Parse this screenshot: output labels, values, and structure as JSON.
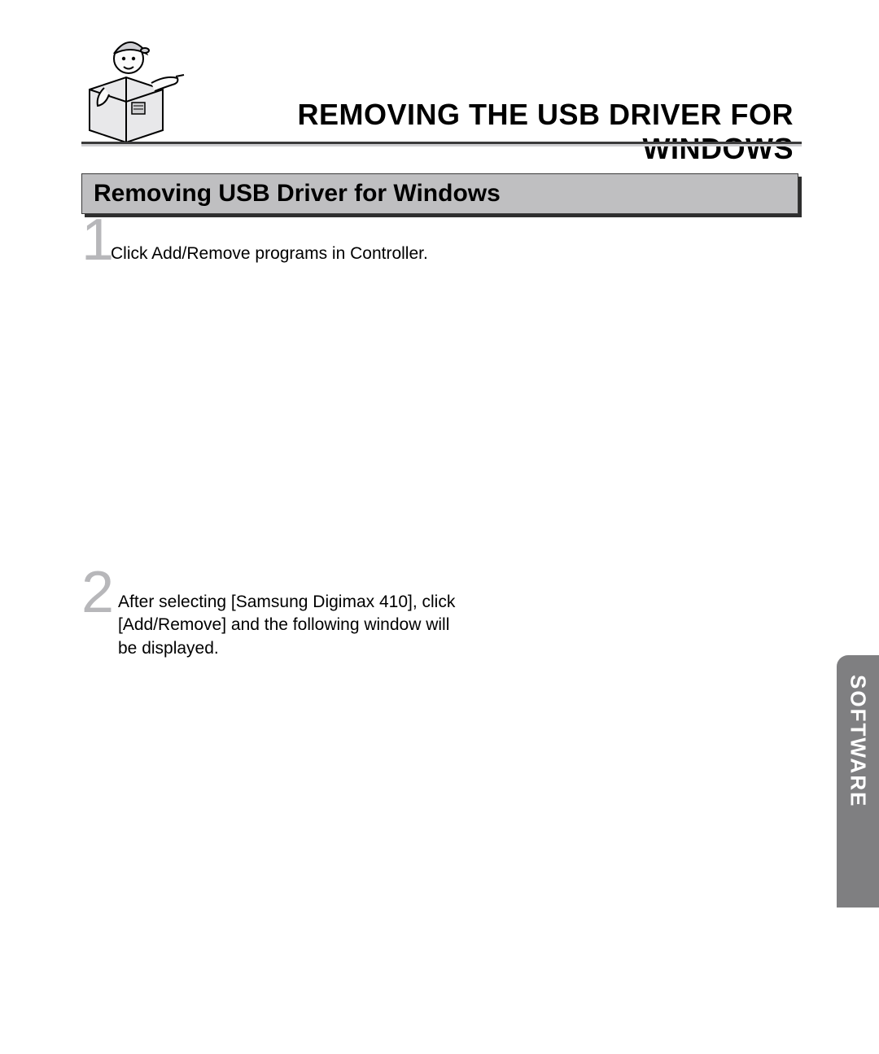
{
  "page_title": "REMOVING THE USB DRIVER FOR WINDOWS",
  "section_heading": "Removing USB Driver for Windows",
  "steps": [
    {
      "number": "1",
      "text": "Click Add/Remove programs in Controller."
    },
    {
      "number": "2",
      "text": "After selecting [Samsung Digimax 410], click [Add/Remove] and the following window will be displayed."
    }
  ],
  "side_tab": "SOFTWARE"
}
